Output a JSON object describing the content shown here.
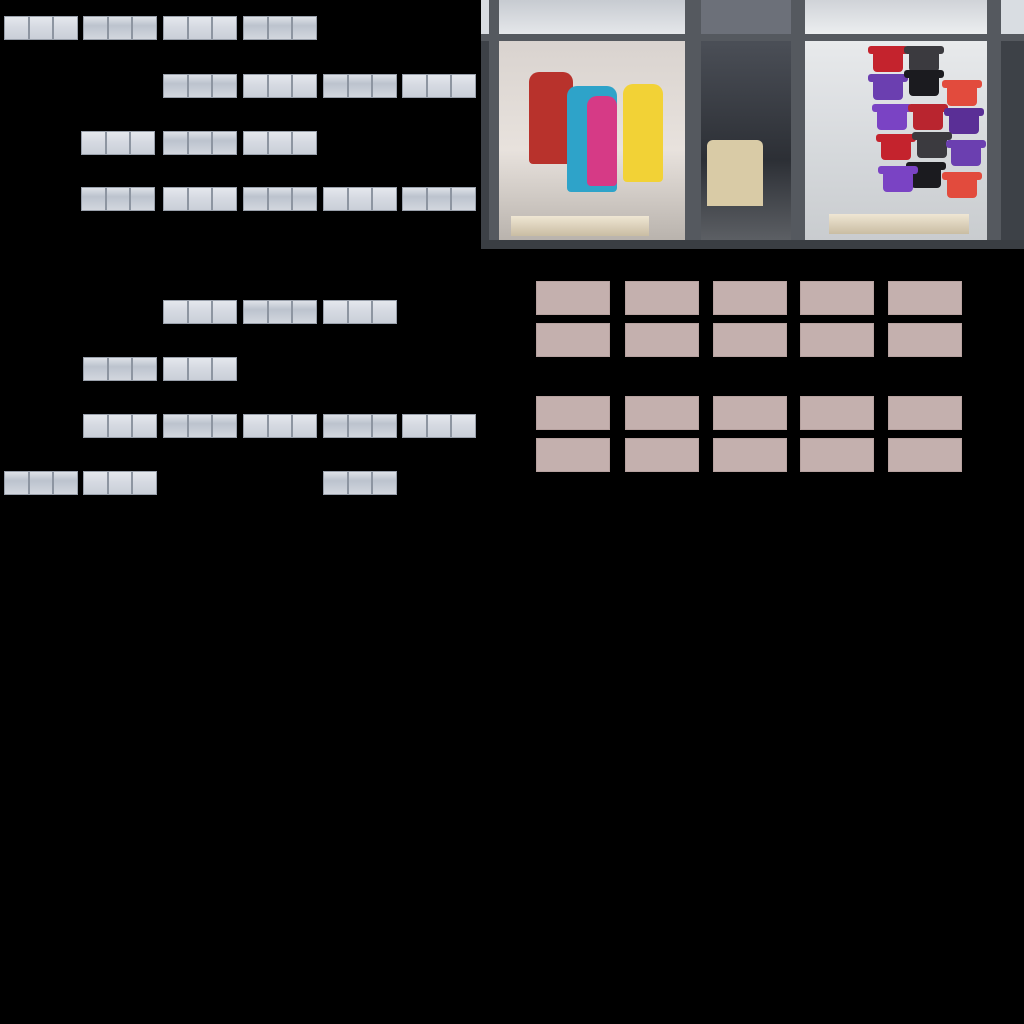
{
  "canvas": {
    "background": "#000000"
  },
  "pane_rows": [
    {
      "row_id": "row-1",
      "groups": 4
    },
    {
      "row_id": "row-2",
      "groups": 4
    },
    {
      "row_id": "row-3",
      "groups": 3
    },
    {
      "row_id": "row-4",
      "groups": 5
    },
    {
      "row_id": "row-5",
      "groups": 3
    },
    {
      "row_id": "row-6",
      "groups": 2
    },
    {
      "row_id": "row-7",
      "groups": 5
    },
    {
      "row_id": "row-8",
      "groups": 3
    }
  ],
  "storefront": {
    "mannequin_colors": [
      "#b8322c",
      "#2ea3c9",
      "#d63a86",
      "#f2d236"
    ],
    "tee_colors": [
      "#c4232d",
      "#3b3a3f",
      "#6b3fb0",
      "#1b1b1f",
      "#e24b3d",
      "#7a43c4",
      "#b9252f",
      "#5a2f96"
    ],
    "counter_color": "#d9cba6",
    "frame_color": "#55595f"
  },
  "tile_grid": {
    "color": "#c4b0ae",
    "rows": 4,
    "columns": 5
  }
}
